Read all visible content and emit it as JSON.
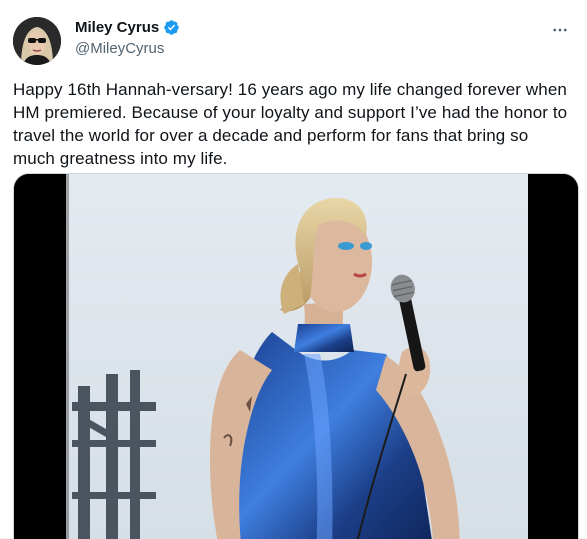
{
  "author": {
    "display_name": "Miley Cyrus",
    "handle": "@MileyCyrus",
    "verified": true,
    "avatar_icon": "profile-photo"
  },
  "tweet": {
    "text": "Happy 16th Hannah-versary! 16 years ago my life changed forever when HM premiered. Because of your loyalty and support I’ve had the honor to travel the world for over a decade and perform for fans that bring so much greatness into my life."
  },
  "media": {
    "type": "video",
    "subject": "performer-with-microphone"
  },
  "colors": {
    "verified_blue": "#1d9bf0",
    "text_primary": "#0f1419",
    "text_secondary": "#536471"
  },
  "icons": {
    "more": "more-dots-icon",
    "verified": "verified-badge-icon"
  }
}
